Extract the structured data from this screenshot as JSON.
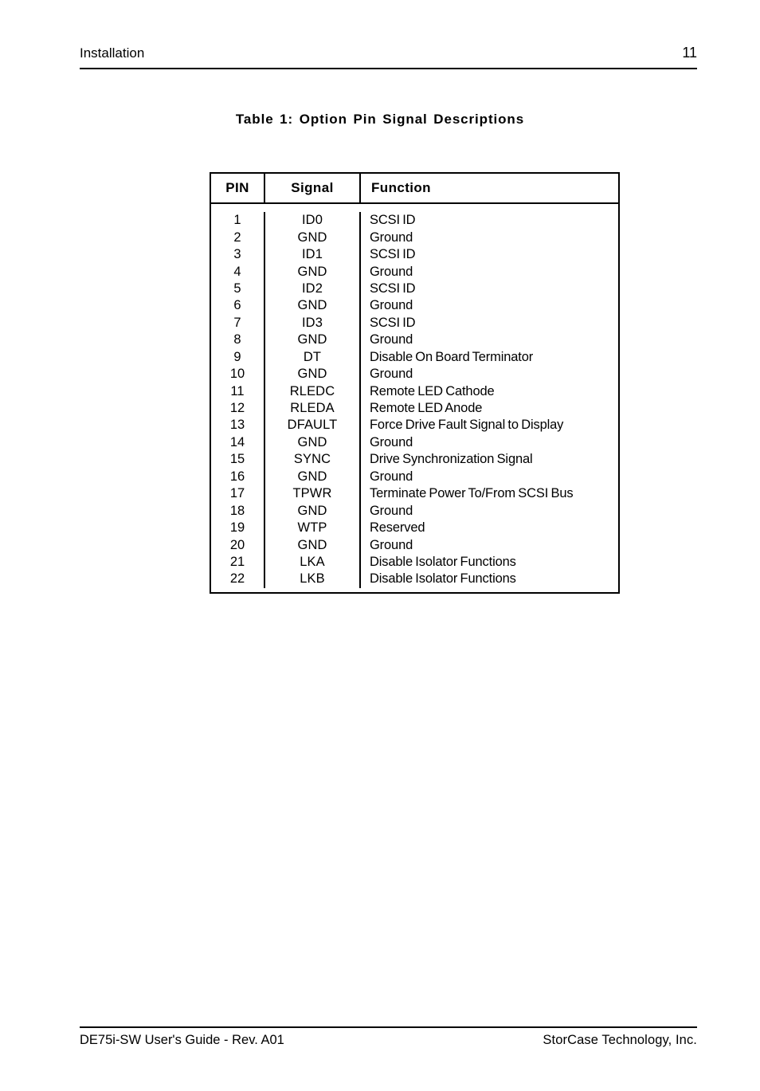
{
  "header": {
    "section_title": "Installation",
    "page_number": "11"
  },
  "caption": {
    "text": "Table 1:  Option  Pin  Signal  Descriptions"
  },
  "table": {
    "columns": [
      "PIN",
      "Signal",
      "Function"
    ],
    "rows": [
      {
        "pin": "1",
        "signal": "ID0",
        "function": "SCSI ID"
      },
      {
        "pin": "2",
        "signal": "GND",
        "function": "Ground"
      },
      {
        "pin": "3",
        "signal": "ID1",
        "function": "SCSI ID"
      },
      {
        "pin": "4",
        "signal": "GND",
        "function": "Ground"
      },
      {
        "pin": "5",
        "signal": "ID2",
        "function": "SCSI ID"
      },
      {
        "pin": "6",
        "signal": "GND",
        "function": "Ground"
      },
      {
        "pin": "7",
        "signal": "ID3",
        "function": "SCSI ID"
      },
      {
        "pin": "8",
        "signal": "GND",
        "function": "Ground"
      },
      {
        "pin": "9",
        "signal": "DT",
        "function": "Disable On Board Terminator"
      },
      {
        "pin": "10",
        "signal": "GND",
        "function": "Ground"
      },
      {
        "pin": "11",
        "signal": "RLEDC",
        "function": "Remote LED Cathode"
      },
      {
        "pin": "12",
        "signal": "RLEDA",
        "function": "Remote LED Anode"
      },
      {
        "pin": "13",
        "signal": "DFAULT",
        "function": "Force Drive Fault Signal to Display"
      },
      {
        "pin": "14",
        "signal": "GND",
        "function": "Ground"
      },
      {
        "pin": "15",
        "signal": "SYNC",
        "function": "Drive Synchronization Signal"
      },
      {
        "pin": "16",
        "signal": "GND",
        "function": "Ground"
      },
      {
        "pin": "17",
        "signal": "TPWR",
        "function": "Terminate Power To/From SCSI Bus"
      },
      {
        "pin": "18",
        "signal": "GND",
        "function": "Ground"
      },
      {
        "pin": "19",
        "signal": "WTP",
        "function": "Reserved"
      },
      {
        "pin": "20",
        "signal": "GND",
        "function": "Ground"
      },
      {
        "pin": "21",
        "signal": "LKA",
        "function": "Disable Isolator Functions"
      },
      {
        "pin": "22",
        "signal": "LKB",
        "function": "Disable Isolator Functions"
      }
    ]
  },
  "footer": {
    "left": "DE75i-SW User's Guide - Rev. A01",
    "right": "StorCase Technology, Inc."
  }
}
